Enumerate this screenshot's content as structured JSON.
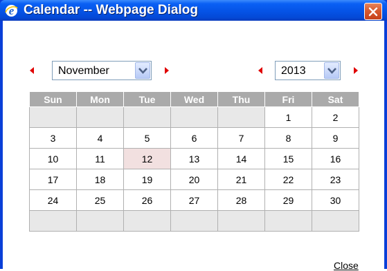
{
  "window": {
    "title": "Calendar -- Webpage Dialog",
    "icons": {
      "app": "ie-icon",
      "close": "close-x-icon"
    }
  },
  "navigation": {
    "month": {
      "selected": "November",
      "prev_icon": "red-left-arrow-icon",
      "next_icon": "red-right-arrow-icon"
    },
    "year": {
      "selected": "2013",
      "prev_icon": "red-left-arrow-icon",
      "next_icon": "red-right-arrow-icon"
    }
  },
  "calendar": {
    "weekdays": [
      "Sun",
      "Mon",
      "Tue",
      "Wed",
      "Thu",
      "Fri",
      "Sat"
    ],
    "weeks": [
      [
        "",
        "",
        "",
        "",
        "",
        "1",
        "2"
      ],
      [
        "3",
        "4",
        "5",
        "6",
        "7",
        "8",
        "9"
      ],
      [
        "10",
        "11",
        "12",
        "13",
        "14",
        "15",
        "16"
      ],
      [
        "17",
        "18",
        "19",
        "20",
        "21",
        "22",
        "23"
      ],
      [
        "24",
        "25",
        "26",
        "27",
        "28",
        "29",
        "30"
      ],
      [
        "",
        "",
        "",
        "",
        "",
        "",
        ""
      ]
    ],
    "highlighted_day": "12"
  },
  "footer": {
    "close_label": "Close"
  },
  "colors": {
    "title_blue": "#0553e6",
    "header_gray": "#aaaaaa",
    "empty_cell": "#e8e8e8",
    "highlight": "#f2e0e0",
    "arrow_red": "#e00000"
  }
}
